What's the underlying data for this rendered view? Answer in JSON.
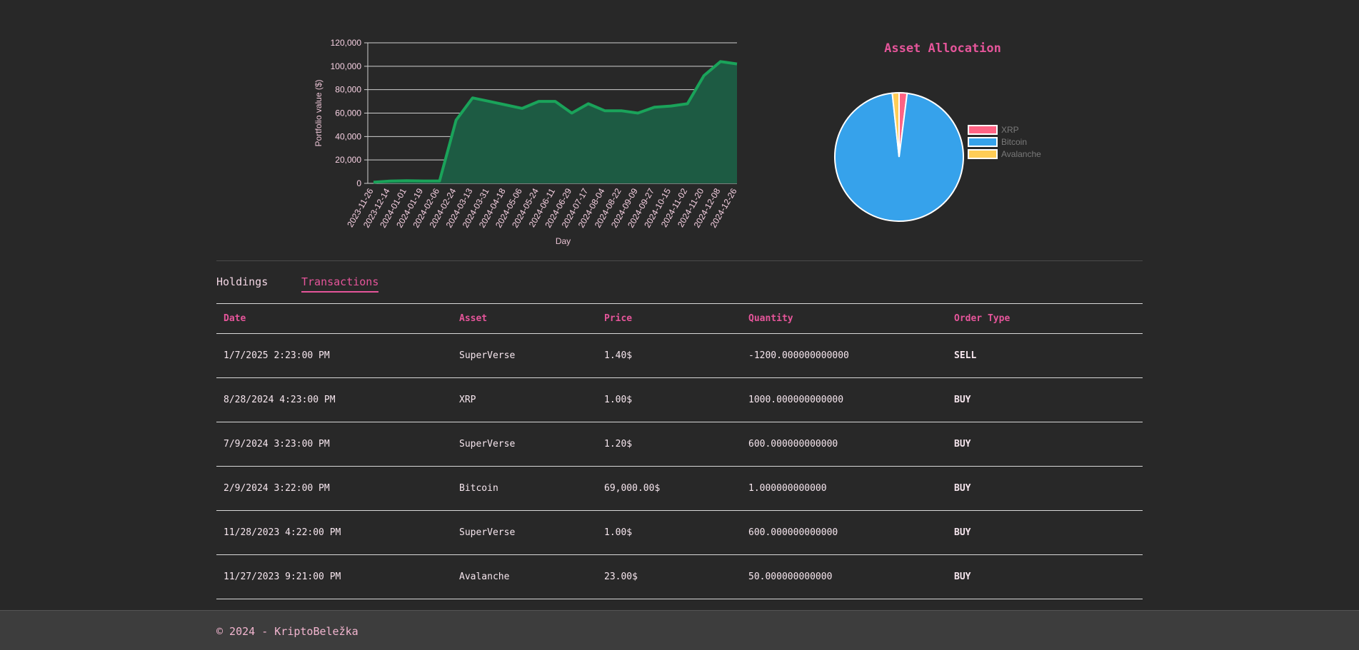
{
  "chart_data": [
    {
      "type": "area",
      "xlabel": "Day",
      "ylabel": "Portfolio value ($)",
      "ylim": [
        0,
        120000
      ],
      "yticks": [
        "0",
        "20,000",
        "40,000",
        "60,000",
        "80,000",
        "100,000",
        "120,000"
      ],
      "x": [
        "2023-11-26",
        "2023-12-14",
        "2024-01-01",
        "2024-01-19",
        "2024-02-06",
        "2024-02-24",
        "2024-03-13",
        "2024-03-31",
        "2024-04-18",
        "2024-05-06",
        "2024-05-24",
        "2024-06-11",
        "2024-06-29",
        "2024-07-17",
        "2024-08-04",
        "2024-08-22",
        "2024-09-09",
        "2024-09-27",
        "2024-10-15",
        "2024-11-02",
        "2024-11-20",
        "2024-12-08",
        "2024-12-26"
      ],
      "values": [
        1000,
        2000,
        2300,
        2100,
        2100,
        54000,
        73000,
        70000,
        67000,
        64000,
        70000,
        70000,
        60000,
        68000,
        62000,
        62000,
        60000,
        65000,
        66000,
        68000,
        92000,
        104000,
        102000
      ],
      "line_color": "#1aa35a",
      "fill_color": "#1d5b43"
    },
    {
      "type": "pie",
      "title": "Asset Allocation",
      "labels": [
        "XRP",
        "Bitcoin",
        "Avalanche"
      ],
      "values": [
        2.0,
        96.3,
        1.7
      ],
      "colors": [
        "#ff6384",
        "#36a2eb",
        "#ffcd56"
      ],
      "legend": "right"
    }
  ],
  "tabs": {
    "holdings": "Holdings",
    "transactions": "Transactions"
  },
  "table": {
    "headers": {
      "date": "Date",
      "asset": "Asset",
      "price": "Price",
      "quantity": "Quantity",
      "order_type": "Order Type"
    },
    "rows": [
      {
        "date": "1/7/2025 2:23:00 PM",
        "asset": "SuperVerse",
        "price": "1.40$",
        "quantity": "-1200.000000000000",
        "order_type": "SELL"
      },
      {
        "date": "8/28/2024 4:23:00 PM",
        "asset": "XRP",
        "price": "1.00$",
        "quantity": "1000.000000000000",
        "order_type": "BUY"
      },
      {
        "date": "7/9/2024 3:23:00 PM",
        "asset": "SuperVerse",
        "price": "1.20$",
        "quantity": "600.000000000000",
        "order_type": "BUY"
      },
      {
        "date": "2/9/2024 3:22:00 PM",
        "asset": "Bitcoin",
        "price": "69,000.00$",
        "quantity": "1.000000000000",
        "order_type": "BUY"
      },
      {
        "date": "11/28/2023 4:22:00 PM",
        "asset": "SuperVerse",
        "price": "1.00$",
        "quantity": "600.000000000000",
        "order_type": "BUY"
      },
      {
        "date": "11/27/2023 9:21:00 PM",
        "asset": "Avalanche",
        "price": "23.00$",
        "quantity": "50.000000000000",
        "order_type": "BUY"
      }
    ]
  },
  "footer": {
    "text": "© 2024 - KriptoBeležka"
  }
}
